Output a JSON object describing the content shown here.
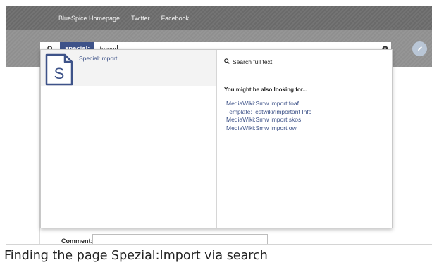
{
  "top_nav": {
    "links": [
      "BlueSpice Homepage",
      "Twitter",
      "Facebook"
    ]
  },
  "search": {
    "namespace_chip": "special:",
    "query": "Impor",
    "icon": "search-icon",
    "clear_icon": "clear-icon"
  },
  "dropdown": {
    "primary_hit": {
      "title": "Special:Import",
      "icon_letter": "S"
    },
    "fulltext_label": "Search full text",
    "also_heading": "You might be also looking for...",
    "suggestions": [
      "MediaWiki:Smw import foaf",
      "Template:Testwiki/Important Info",
      "MediaWiki:Smw import skos",
      "MediaWiki:Smw import owl"
    ]
  },
  "form": {
    "comment_label": "Comment:"
  },
  "caption": "Finding the page Spezial:Import via search",
  "colors": {
    "accent": "#3e5389",
    "nav_bg": "#6a6a6a",
    "toolbar_bg": "#8f8f8f"
  }
}
